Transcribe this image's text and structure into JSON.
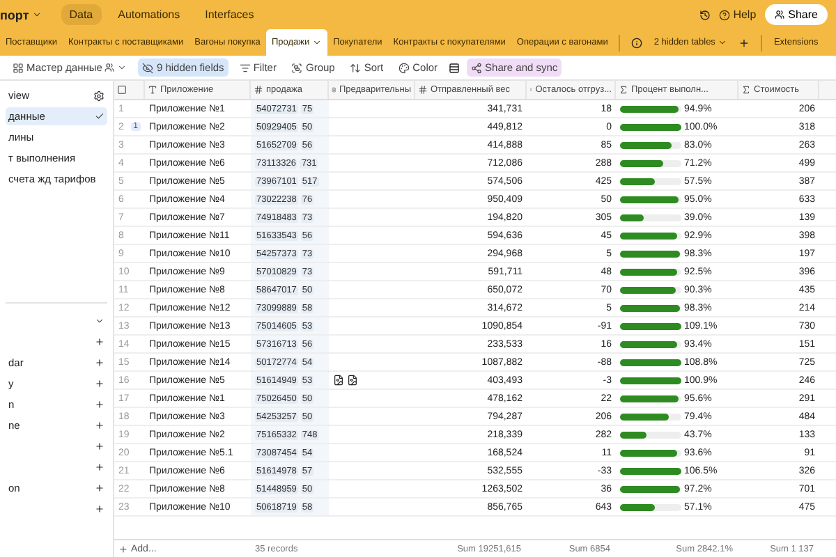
{
  "app": {
    "base_name": "порт",
    "nav": [
      {
        "label": "Data",
        "selected": true
      },
      {
        "label": "Automations",
        "selected": false
      },
      {
        "label": "Interfaces",
        "selected": false
      }
    ],
    "help": "Help",
    "share": "Share"
  },
  "table_tabs": [
    {
      "label": "Поставщики",
      "selected": false
    },
    {
      "label": "Контракты с поставщиками",
      "selected": false
    },
    {
      "label": "Вагоны покупка",
      "selected": false
    },
    {
      "label": "Продажи",
      "selected": true
    },
    {
      "label": "Покупатели",
      "selected": false
    },
    {
      "label": "Контракты с покупателями",
      "selected": false
    },
    {
      "label": "Операции с вагонами",
      "selected": false
    }
  ],
  "hidden_tables": "2 hidden tables",
  "extensions": "Extensions",
  "toolbar": {
    "view": "Мастер данные",
    "hidden_fields": "9 hidden fields",
    "filter": "Filter",
    "group": "Group",
    "sort": "Sort",
    "color_label": "Color",
    "share_sync": "Share and sync"
  },
  "sidebar": {
    "search": "view",
    "views": [
      {
        "label": "данные",
        "selected": true
      },
      {
        "label": "лины",
        "selected": false
      },
      {
        "label": "т выполнения",
        "selected": false
      },
      {
        "label": "счета жд тарифов",
        "selected": false
      }
    ],
    "create": [
      {
        "kind": "blank"
      },
      {
        "kind": "named",
        "label": "dar"
      },
      {
        "kind": "named",
        "label": "y"
      },
      {
        "kind": "named",
        "label": "n"
      },
      {
        "kind": "named",
        "label": "ne"
      },
      {
        "kind": "blank"
      },
      {
        "kind": "blank"
      },
      {
        "kind": "named",
        "label": "on"
      },
      {
        "kind": "blank"
      }
    ]
  },
  "columns": [
    "Приложение",
    "продажа",
    "Предварительны",
    "Отправленный вес",
    "Осталось отгруз...",
    "Процент выполн...",
    "Стоимость"
  ],
  "rows": [
    {
      "n": "1",
      "name": "Приложение №1",
      "ids": [
        "54072731",
        "75"
      ],
      "weight": "341,731",
      "remaining": "18",
      "level": 0.949,
      "percent": "94.9%",
      "cost": "206"
    },
    {
      "n": "2",
      "comments": "1",
      "name": "Приложение №2",
      "ids": [
        "50929405",
        "50"
      ],
      "weight": "449,812",
      "remaining": "0",
      "level": 1,
      "percent": "100.0%",
      "cost": "318"
    },
    {
      "n": "3",
      "name": "Приложение №3",
      "ids": [
        "51652709",
        "56"
      ],
      "weight": "414,888",
      "remaining": "85",
      "level": 0.83,
      "percent": "83.0%",
      "cost": "263"
    },
    {
      "n": "4",
      "name": "Приложение №6",
      "ids": [
        "73113326",
        "731"
      ],
      "weight": "712,086",
      "remaining": "288",
      "level": 0.712,
      "percent": "71.2%",
      "cost": "499"
    },
    {
      "n": "5",
      "name": "Приложение №5",
      "ids": [
        "73967101",
        "517"
      ],
      "weight": "574,506",
      "remaining": "425",
      "level": 0.575,
      "percent": "57.5%",
      "cost": "387"
    },
    {
      "n": "6",
      "name": "Приложение №4",
      "ids": [
        "73022238",
        "76"
      ],
      "weight": "950,409",
      "remaining": "50",
      "level": 0.95,
      "percent": "95.0%",
      "cost": "633"
    },
    {
      "n": "7",
      "name": "Приложение №7",
      "ids": [
        "74918483",
        "73"
      ],
      "weight": "194,820",
      "remaining": "305",
      "level": 0.39,
      "percent": "39.0%",
      "cost": "139"
    },
    {
      "n": "8",
      "name": "Приложение №11",
      "ids": [
        "51633543",
        "56"
      ],
      "weight": "594,636",
      "remaining": "45",
      "level": 0.929,
      "percent": "92.9%",
      "cost": "398"
    },
    {
      "n": "9",
      "name": "Приложение №10",
      "ids": [
        "54257373",
        "73"
      ],
      "weight": "294,968",
      "remaining": "5",
      "level": 0.983,
      "percent": "98.3%",
      "cost": "197"
    },
    {
      "n": "10",
      "name": "Приложение №9",
      "ids": [
        "57010829",
        "73"
      ],
      "weight": "591,711",
      "remaining": "48",
      "level": 0.925,
      "percent": "92.5%",
      "cost": "396"
    },
    {
      "n": "11",
      "name": "Приложение №8",
      "ids": [
        "58647017",
        "50"
      ],
      "weight": "650,072",
      "remaining": "70",
      "level": 0.903,
      "percent": "90.3%",
      "cost": "435"
    },
    {
      "n": "12",
      "name": "Приложение №12",
      "ids": [
        "73099889",
        "58"
      ],
      "weight": "314,672",
      "remaining": "5",
      "level": 0.983,
      "percent": "98.3%",
      "cost": "214"
    },
    {
      "n": "13",
      "name": "Приложение №13",
      "ids": [
        "75014605",
        "53"
      ],
      "weight": "1090,854",
      "remaining": "-91",
      "level": 1,
      "percent": "109.1%",
      "cost": "730"
    },
    {
      "n": "14",
      "name": "Приложение №15",
      "ids": [
        "57316713",
        "56"
      ],
      "weight": "233,533",
      "remaining": "16",
      "level": 0.934,
      "percent": "93.4%",
      "cost": "151"
    },
    {
      "n": "15",
      "name": "Приложение №14",
      "ids": [
        "50172774",
        "54"
      ],
      "weight": "1087,882",
      "remaining": "-88",
      "level": 1,
      "percent": "108.8%",
      "cost": "725"
    },
    {
      "n": "16",
      "name": "Приложение №5",
      "ids": [
        "51614949",
        "53"
      ],
      "attachment": true,
      "weight": "403,493",
      "remaining": "-3",
      "level": 1,
      "percent": "100.9%",
      "cost": "246"
    },
    {
      "n": "17",
      "name": "Приложение №1",
      "ids": [
        "75026450",
        "50"
      ],
      "weight": "478,162",
      "remaining": "22",
      "level": 0.956,
      "percent": "95.6%",
      "cost": "291"
    },
    {
      "n": "18",
      "name": "Приложение №3",
      "ids": [
        "54253257",
        "50"
      ],
      "weight": "794,287",
      "remaining": "206",
      "level": 0.794,
      "percent": "79.4%",
      "cost": "484"
    },
    {
      "n": "19",
      "name": "Приложение №2",
      "ids": [
        "75165332",
        "748"
      ],
      "weight": "218,339",
      "remaining": "282",
      "level": 0.437,
      "percent": "43.7%",
      "cost": "133"
    },
    {
      "n": "20",
      "name": "Приложение №5.1",
      "ids": [
        "73087454",
        "54"
      ],
      "weight": "168,524",
      "remaining": "11",
      "level": 0.936,
      "percent": "93.6%",
      "cost": "91"
    },
    {
      "n": "21",
      "name": "Приложение №6",
      "ids": [
        "51614978",
        "57"
      ],
      "weight": "532,555",
      "remaining": "-33",
      "level": 1,
      "percent": "106.5%",
      "cost": "326"
    },
    {
      "n": "22",
      "name": "Приложение №8",
      "ids": [
        "51448959",
        "50"
      ],
      "weight": "1263,502",
      "remaining": "36",
      "level": 0.972,
      "percent": "97.2%",
      "cost": "701"
    },
    {
      "n": "23",
      "name": "Приложение №10",
      "ids": [
        "50618719",
        "58"
      ],
      "weight": "856,765",
      "remaining": "643",
      "level": 0.571,
      "percent": "57.1%",
      "cost": "475"
    }
  ],
  "footer": {
    "add": "Add...",
    "records": "35 records",
    "sums": [
      "Sum 19251,615",
      "Sum 6854",
      "Sum 2842.1%",
      "Sum 1 137"
    ]
  }
}
